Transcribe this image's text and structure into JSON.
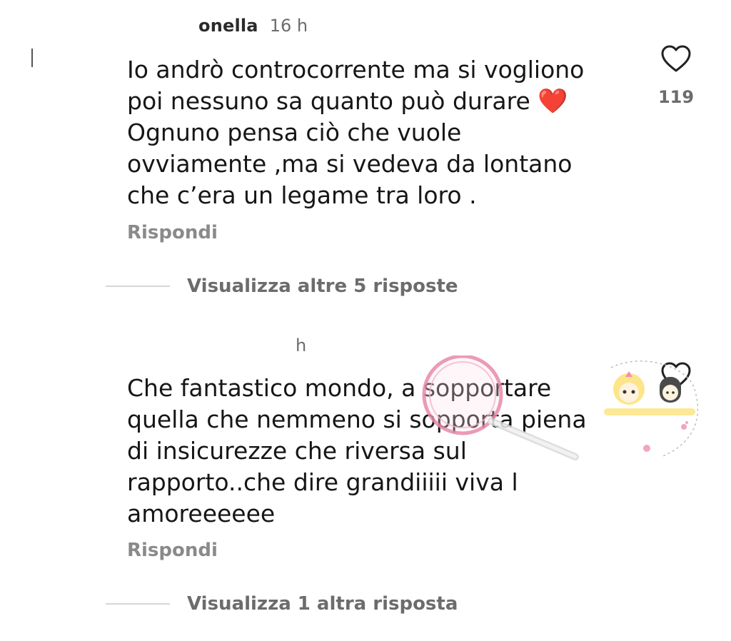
{
  "comments": [
    {
      "username": "onella",
      "timestamp": "16 h",
      "lines": [
        "Io andrò controcorrente ma si vogliono",
        "poi nessuno sa quanto può durare",
        "Ognuno pensa ciò che vuole",
        "ovviamente ,ma si vedeva da lontano",
        "che c’era un legame tra loro ."
      ],
      "emoji": "❤️",
      "likes": "119",
      "reply_label": "Rispondi",
      "view_replies_label": "Visualizza altre 5 risposte"
    },
    {
      "username": "",
      "timestamp": "h",
      "lines": [
        "Che fantastico mondo, a sopportare",
        "quella che nemmeno si sopporta piena",
        "di insicurezze che riversa sul",
        "rapporto..che dire grandiiiii viva l",
        "amoreeeeee"
      ],
      "reply_label": "Rispondi",
      "view_replies_label": "Visualizza 1 altra risposta"
    }
  ],
  "colors": {
    "text": "#161616",
    "muted": "#6c6c6c",
    "reply": "#8a8a8a",
    "heart_emoji": "#e0302a",
    "watermark": "#e88aa8"
  },
  "icons": {
    "like": "heart-outline-icon",
    "watermark": "magnifier-watermark-icon"
  }
}
